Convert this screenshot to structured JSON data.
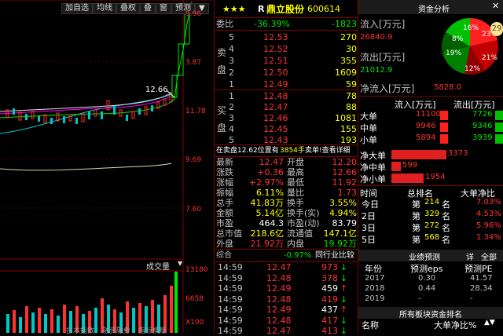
{
  "toolbar": {
    "items": [
      "加自选",
      "均线",
      "叠权",
      "叠",
      "窗",
      "预测"
    ]
  },
  "chart": {
    "y_labels": [
      "9.96",
      "3.87",
      "11.78",
      "9.69",
      "7.60"
    ],
    "last_price_label": "12.66",
    "volume_header": "成交量",
    "volume_labels": [
      "13180",
      "6658",
      "X100"
    ],
    "bottom_tabs": [
      "技术指数",
      "融资融券",
      "指标模版"
    ]
  },
  "stock": {
    "stars": "★★★",
    "flag": "R",
    "name": "鼎立股份",
    "code": "600614"
  },
  "weibi": {
    "label": "委比",
    "pct": "-36.39%",
    "diff": "-1823"
  },
  "sell_label": [
    "卖",
    "盘"
  ],
  "buy_label": [
    "买",
    "盘"
  ],
  "sells": [
    {
      "lvl": "5",
      "price": "12.53",
      "vol": "270"
    },
    {
      "lvl": "4",
      "price": "12.52",
      "vol": "30"
    },
    {
      "lvl": "3",
      "price": "12.51",
      "vol": "355"
    },
    {
      "lvl": "2",
      "price": "12.50",
      "vol": "1609"
    },
    {
      "lvl": "1",
      "price": "12.49",
      "vol": "59"
    }
  ],
  "buys": [
    {
      "lvl": "1",
      "price": "12.48",
      "vol": "78"
    },
    {
      "lvl": "2",
      "price": "12.47",
      "vol": "88"
    },
    {
      "lvl": "3",
      "price": "12.46",
      "vol": "1081"
    },
    {
      "lvl": "4",
      "price": "12.45",
      "vol": "155"
    },
    {
      "lvl": "5",
      "price": "12.43",
      "vol": "193"
    }
  ],
  "notice": {
    "text": "在卖盘12.62位置有",
    "amount": "3854手",
    "tail": "卖单!查看详细"
  },
  "quote": [
    {
      "l1": "最新",
      "v1": "12.47",
      "c1": "red",
      "l2": "开盘",
      "v2": "12.20",
      "c2": "red"
    },
    {
      "l1": "涨跌",
      "v1": "+0.36",
      "c1": "red",
      "l2": "最高",
      "v2": "12.66",
      "c2": "red"
    },
    {
      "l1": "涨幅",
      "v1": "+2.97%",
      "c1": "red",
      "l2": "最低",
      "v2": "11.92",
      "c2": "red"
    },
    {
      "l1": "振幅",
      "v1": "6.11%",
      "c1": "yellow",
      "l2": "量比",
      "v2": "1.73",
      "c2": "red"
    },
    {
      "l1": "总手",
      "v1": "41.83万",
      "c1": "yellow",
      "l2": "换手",
      "v2": "3.55%",
      "c2": "yellow"
    },
    {
      "l1": "金额",
      "v1": "5.14亿",
      "c1": "yellow",
      "l2": "换手(实)",
      "v2": "4.94%",
      "c2": "yellow"
    },
    {
      "l1": "市盈",
      "v1": "464.3",
      "c1": "white",
      "l2": "市盈(动)",
      "v2": "83.79",
      "c2": "white"
    },
    {
      "l1": "总市值",
      "v1": "218.6亿",
      "c1": "yellow",
      "l2": "流通值",
      "v2": "147.1亿",
      "c2": "yellow"
    },
    {
      "l1": "外盘",
      "v1": "21.92万",
      "c1": "red",
      "l2": "内盘",
      "v2": "19.92万",
      "c2": "green"
    }
  ],
  "zonghe": {
    "label": "综合",
    "pct": "-0.97%",
    "rank": "同行业比较"
  },
  "ticks": [
    {
      "time": "14:59",
      "price": "12.47",
      "vol": "973",
      "dir": "down"
    },
    {
      "time": "14:59",
      "price": "12.48",
      "vol": "378",
      "dir": "down"
    },
    {
      "time": "14:59",
      "price": "12.49",
      "vol": "459",
      "dir": "up"
    },
    {
      "time": "14:59",
      "price": "12.48",
      "vol": "419",
      "dir": "down"
    },
    {
      "time": "14:59",
      "price": "12.49",
      "vol": "437",
      "dir": "up"
    },
    {
      "time": "14:59",
      "price": "12.48",
      "vol": "417",
      "dir": "down"
    },
    {
      "time": "14:59",
      "price": "12.47",
      "vol": "413",
      "dir": "down"
    }
  ],
  "fund": {
    "header": "资金分析",
    "pie_pcts": [
      "23%",
      "21%",
      "12%",
      "19%",
      "8%",
      "16%"
    ],
    "pie_badge": "29",
    "inflow_label": "流入[万元]",
    "inflow": "26840.9",
    "outflow_label": "流出[万元]",
    "outflow": "21012.9",
    "net_label": "净流入[万元]",
    "net": "5828.0",
    "table_head": [
      "流入[万元]",
      "流出[万元]"
    ],
    "table": [
      {
        "name": "大单",
        "in": "11100",
        "out": "7726"
      },
      {
        "name": "中单",
        "in": "9946",
        "out": "9346"
      },
      {
        "name": "小单",
        "in": "5894",
        "out": "3939"
      }
    ],
    "net_rows": [
      {
        "name": "净大单",
        "val": "3373"
      },
      {
        "name": "净中单",
        "val": "599"
      },
      {
        "name": "净小单",
        "val": "1954"
      }
    ],
    "rank_head": [
      "时间",
      "总排名",
      "大单净比"
    ],
    "ranks": [
      {
        "t": "今日",
        "rank": "214",
        "pct": "7.03%"
      },
      {
        "t": "2日",
        "rank": "329",
        "pct": "4.53%"
      },
      {
        "t": "3日",
        "rank": "272",
        "pct": "5.96%"
      },
      {
        "t": "5日",
        "rank": "568",
        "pct": "1.34%"
      }
    ],
    "rank_prefix": "第",
    "rank_suffix": "名"
  },
  "forecast": {
    "title": "业绩预测",
    "tabs": [
      "详",
      "全部"
    ],
    "head": [
      "年份",
      "预测eps",
      "预测PE"
    ],
    "rows": [
      {
        "y": "2017",
        "eps": "0.30",
        "pe": "41.57"
      },
      {
        "y": "2018",
        "eps": "0.44",
        "pe": "28.34"
      },
      {
        "y": "2019",
        "eps": "-",
        "pe": "-"
      }
    ]
  },
  "sector": {
    "title": "所有板块资金排名",
    "head": [
      "名称",
      "大单净比%"
    ]
  }
}
